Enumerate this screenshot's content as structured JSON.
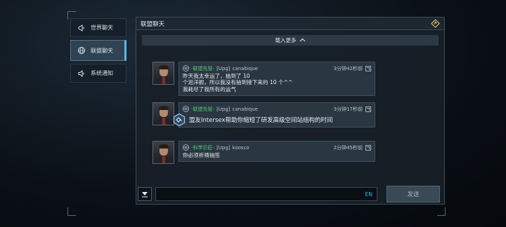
{
  "sidebar": {
    "items": [
      {
        "label": "世界聊天",
        "icon": "megaphone-icon"
      },
      {
        "label": "联盟聊天",
        "icon": "globe-icon"
      },
      {
        "label": "系统通知",
        "icon": "speaker-icon"
      }
    ]
  },
  "panel": {
    "title": "联盟聊天",
    "load_more": "载入更多"
  },
  "messages": [
    {
      "alliance": "-联盟先驱-",
      "tag": "[Upg]",
      "name": "canabique",
      "time": "3分钟42秒前",
      "text": "昨天我太幸运了，抽到了 10\n个巡洋舰，所以我没有抽到接下来的 10 个^^\n我耗尽了我所有的运气"
    },
    {
      "alliance": "-联盟先驱-",
      "tag": "[Upg]",
      "name": "canabique",
      "time": "3分钟17秒前",
      "text": ""
    },
    {
      "alliance": "-科学巨匠-",
      "tag": "[Upg]",
      "name": "koosco",
      "time": "2分钟45秒前",
      "text": "你必须祈祷抽签"
    }
  ],
  "notice": {
    "text": "盟友Intersex帮助你缩短了研发高级空间站结构的时间"
  },
  "input": {
    "lang": "EN",
    "send_label": "发送"
  },
  "colors": {
    "alliance_green": "#4fd07a",
    "accent_blue": "#58b6e8"
  }
}
